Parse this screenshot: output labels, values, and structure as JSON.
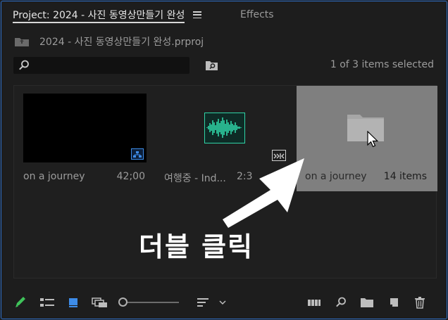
{
  "tabs": {
    "project": "Project: 2024 - 사진 동영상만들기 완성",
    "effects": "Effects"
  },
  "project_file": {
    "name": "2024 - 사진 동영상만들기 완성.prproj"
  },
  "search": {
    "value": "",
    "placeholder": ""
  },
  "selection_status": "1 of 3 items selected",
  "items": [
    {
      "name": "on a journey",
      "meta": "42;00",
      "type": "sequence",
      "selected": false
    },
    {
      "name": "여행중 - Ind...",
      "meta": "2:3",
      "type": "audio",
      "selected": false
    },
    {
      "name": "on a journey",
      "meta": "14 items",
      "type": "bin",
      "selected": true
    }
  ],
  "annotation": "더블 클릭",
  "colors": {
    "accent": "#2f6fc9",
    "audio": "#2fd4a7",
    "sequence_badge": "#3d8ce8",
    "selected_bg": "#7f7f7f"
  },
  "toolbar_icons": [
    "pencil-icon",
    "list-view-icon",
    "icon-view-icon",
    "freeform-view-icon",
    "zoom-slider",
    "sort-icon",
    "chevron-down-icon",
    "automate-to-sequence-icon",
    "find-icon",
    "new-bin-icon",
    "new-item-icon",
    "trash-icon"
  ]
}
